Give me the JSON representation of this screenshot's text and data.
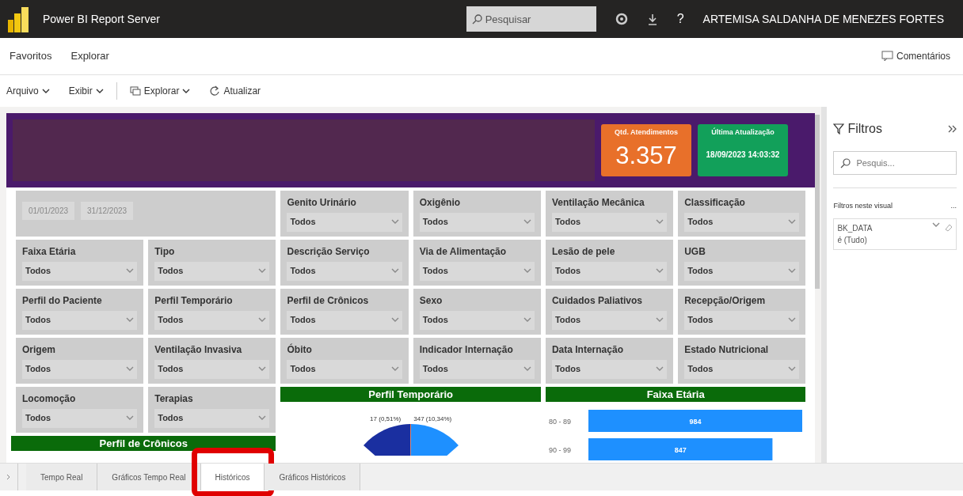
{
  "app": {
    "title": "Power BI Report Server",
    "search_placeholder": "Pesquisar",
    "help": "?",
    "user": "ARTEMISA SALDANHA DE MENEZES FORTES"
  },
  "nav": {
    "items": [
      "Favoritos",
      "Explorar"
    ],
    "comments": "Comentários"
  },
  "toolbar": [
    {
      "label": "Arquivo",
      "kind": "menu"
    },
    {
      "label": "Exibir",
      "kind": "menu"
    },
    {
      "label": "Explorar",
      "kind": "explore"
    },
    {
      "label": "Atualizar",
      "kind": "refresh"
    }
  ],
  "kpis": [
    {
      "title": "Qtd. Atendimentos",
      "value": "3.357",
      "color": "#e8702a"
    },
    {
      "title": "Última Atualização",
      "value": "18/09/2023 14:03:32",
      "color": "#12a05a"
    }
  ],
  "date_range": {
    "start": "01/01/2023",
    "end": "31/12/2023"
  },
  "slicers": [
    {
      "label": "Genito Urinário",
      "value": "Todos"
    },
    {
      "label": "Oxigênio",
      "value": "Todos"
    },
    {
      "label": "Ventilação Mecânica",
      "value": "Todos"
    },
    {
      "label": "Classificação",
      "value": "Todos"
    },
    {
      "label": "Faixa Etária",
      "value": "Todos"
    },
    {
      "label": "Tipo",
      "value": "Todos"
    },
    {
      "label": "Descrição Serviço",
      "value": "Todos"
    },
    {
      "label": "Via de Alimentação",
      "value": "Todos"
    },
    {
      "label": "Lesão de pele",
      "value": "Todos"
    },
    {
      "label": "UGB",
      "value": "Todos"
    },
    {
      "label": "Perfil do Paciente",
      "value": "Todos"
    },
    {
      "label": "Perfil Temporário",
      "value": "Todos"
    },
    {
      "label": "Perfil de Crônicos",
      "value": "Todos"
    },
    {
      "label": "Sexo",
      "value": "Todos"
    },
    {
      "label": "Cuidados Paliativos",
      "value": "Todos"
    },
    {
      "label": "Recepção/Origem",
      "value": "Todos"
    },
    {
      "label": "Origem",
      "value": "Todos"
    },
    {
      "label": "Ventilação Invasiva",
      "value": "Todos"
    },
    {
      "label": "Óbito",
      "value": "Todos"
    },
    {
      "label": "Indicador Internação",
      "value": "Todos"
    },
    {
      "label": "Data Internação",
      "value": "Todos"
    },
    {
      "label": "Estado Nutricional",
      "value": "Todos"
    },
    {
      "label": "Locomoção",
      "value": "Todos"
    },
    {
      "label": "Terapias",
      "value": "Todos"
    }
  ],
  "perfil_temporario": {
    "title": "Perfil Temporário",
    "slice_labels": [
      "17 (0,51%)",
      "347 (10,34%)"
    ]
  },
  "faixa_etaria": {
    "title": "Faixa Etária",
    "chart_data": {
      "type": "bar",
      "orientation": "horizontal",
      "categories": [
        "80 - 89",
        "90 - 99"
      ],
      "values": [
        984,
        847
      ],
      "data_labels": true
    }
  },
  "perfil_cronicos": {
    "title": "Perfil de Crônicos"
  },
  "filters_pane": {
    "title": "Filtros",
    "search_placeholder": "Pesquis...",
    "section": "Filtros neste visual",
    "more": "...",
    "cards": [
      {
        "field": "BK_DATA",
        "value": "é (Tudo)"
      }
    ]
  },
  "pages": [
    {
      "label": "Tempo Real",
      "selected": false,
      "highlighted": false
    },
    {
      "label": "Gráficos Tempo Real",
      "selected": false,
      "highlighted": false
    },
    {
      "label": "Históricos",
      "selected": true,
      "highlighted": true
    },
    {
      "label": "Gráficos Históricos",
      "selected": false,
      "highlighted": false
    }
  ]
}
